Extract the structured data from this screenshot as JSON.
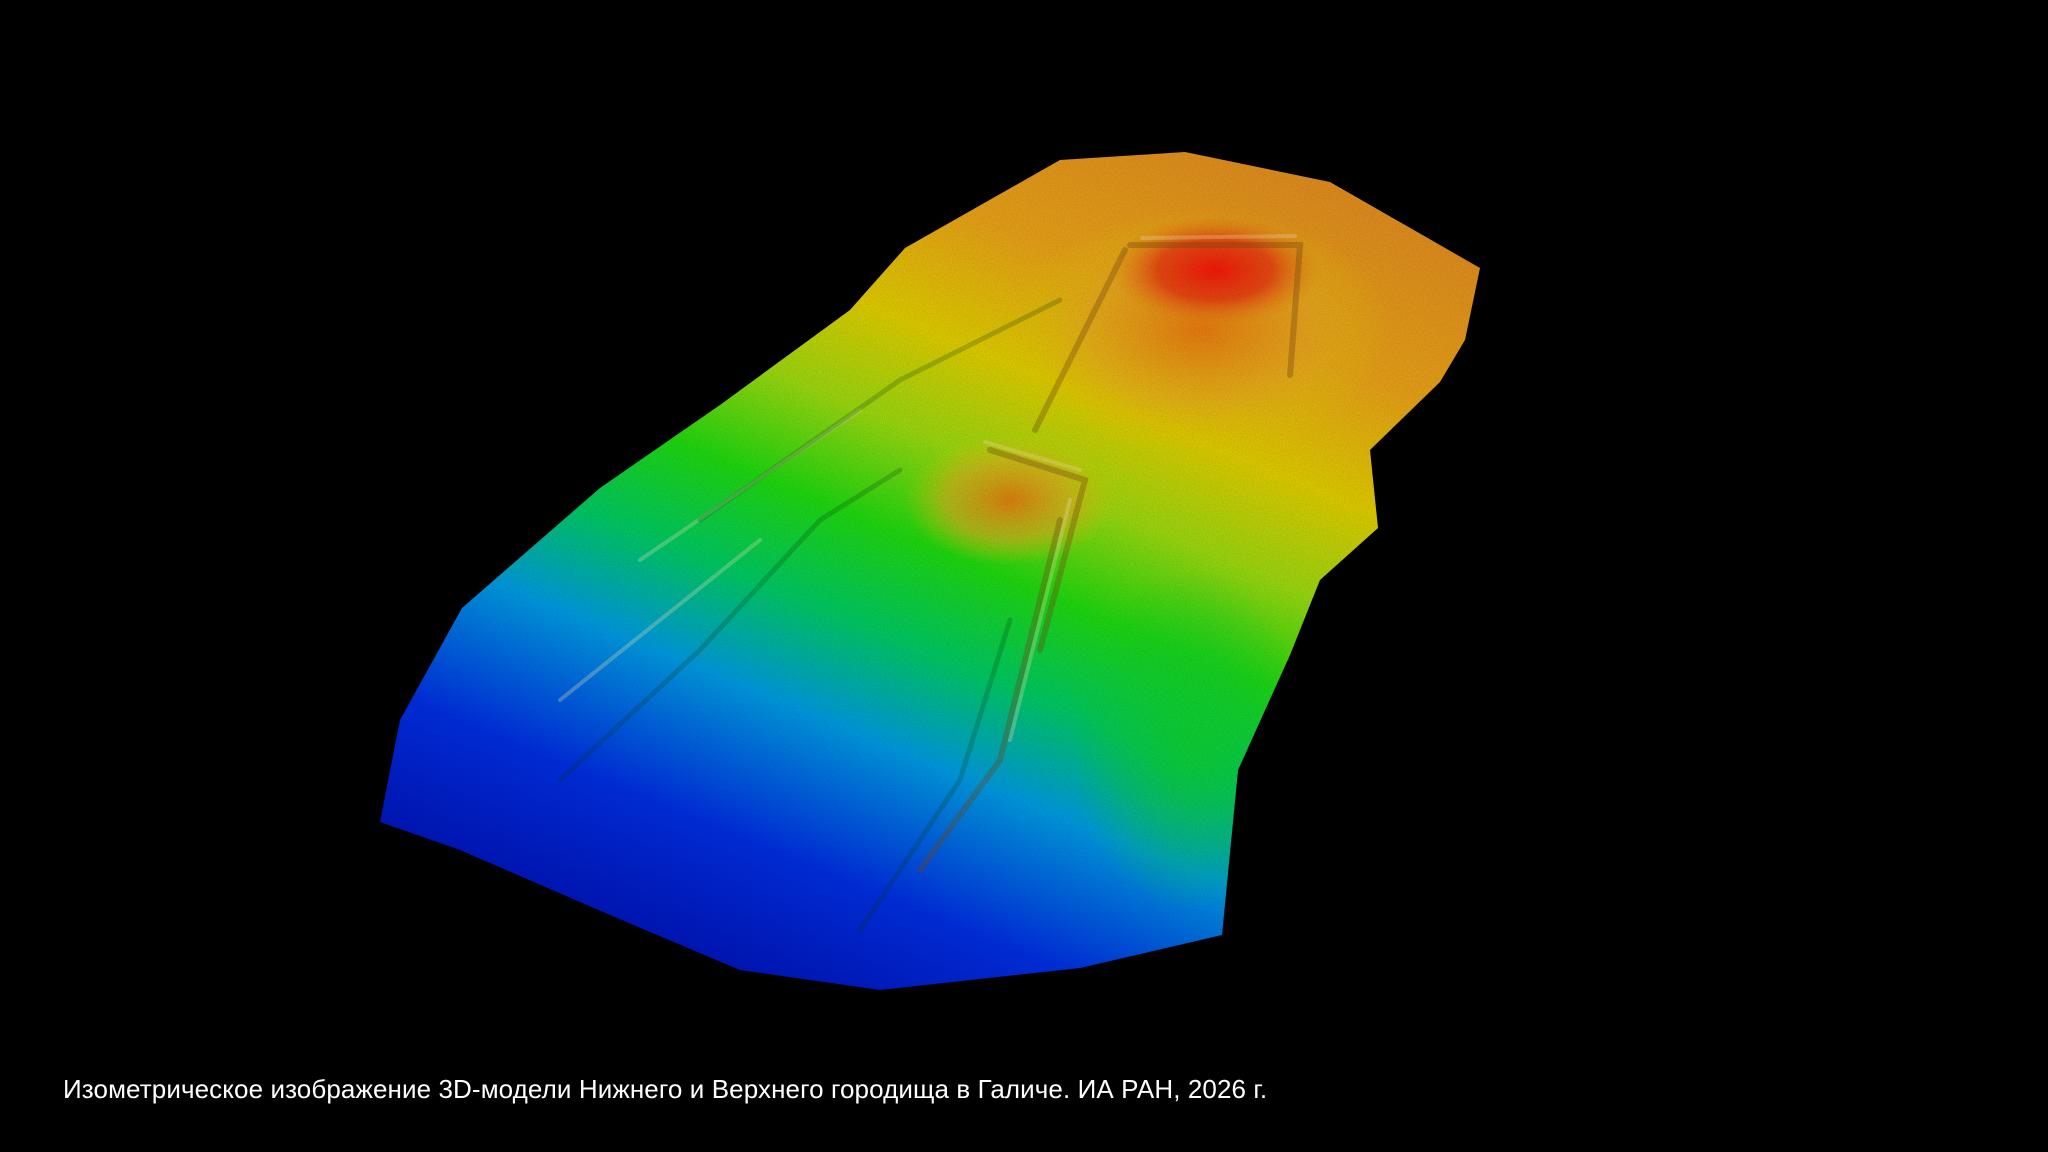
{
  "background_color": "#000000",
  "caption": {
    "text": "Изометрическое изображение 3D-модели Нижнего и Верхнего городища в Галиче. ИА РАН, 2026 г.",
    "color": "#ffffff"
  },
  "elevation_colormap": {
    "low": "#0018c8",
    "mid_low": "#00b4e0",
    "mid": "#10e020",
    "mid_high": "#e8d800",
    "high_orange": "#f09a18",
    "peak": "#e81810"
  }
}
